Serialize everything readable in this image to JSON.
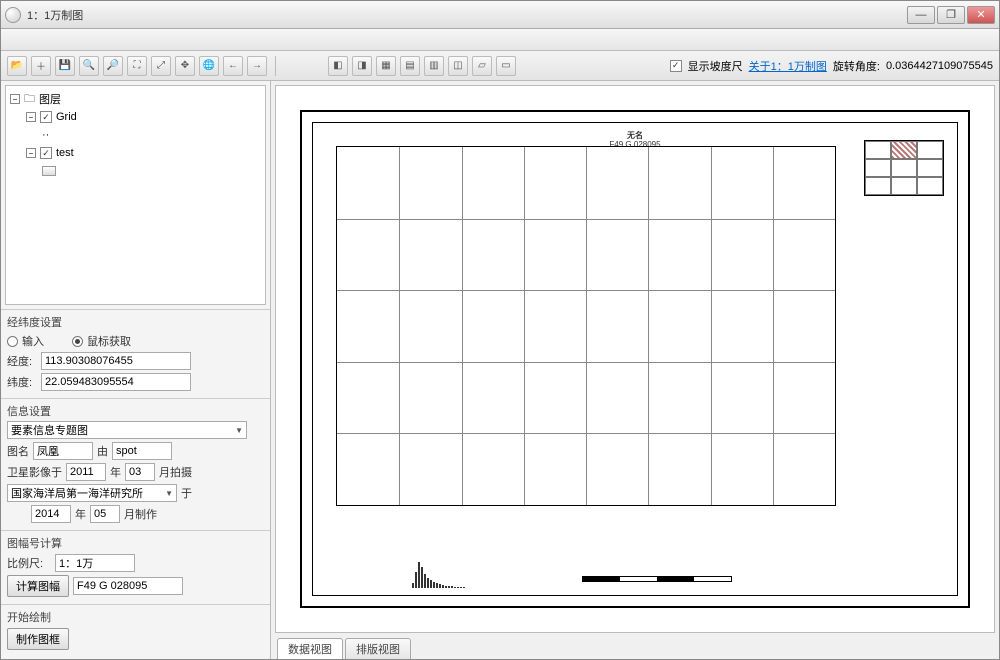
{
  "window": {
    "title": "1：1万制图"
  },
  "menubar": {
    "items": [
      "",
      "",
      ""
    ]
  },
  "toolbar": {
    "show_scale_label": "显示坡度尺",
    "about_label": "关于1：1万制图",
    "rotation_label": "旋转角度:",
    "rotation_value": "0.0364427109075545"
  },
  "tree": {
    "root": "图层",
    "items": [
      {
        "label": "Grid",
        "checked": true
      },
      {
        "label": "test",
        "checked": true
      }
    ]
  },
  "coord": {
    "header": "经纬度设置",
    "opt_input": "输入",
    "opt_mouse": "鼠标获取",
    "lon_label": "经度:",
    "lon_value": "113.90308076455",
    "lat_label": "纬度:",
    "lat_value": "22.059483095554"
  },
  "info": {
    "header": "信息设置",
    "theme": "要素信息专题图",
    "mapname_label": "图名",
    "mapname_value": "凤凰",
    "by_label": "由",
    "by_value": "spot",
    "sat_prefix": "卫星影像于",
    "year1": "2011",
    "year_unit": "年",
    "month1": "03",
    "month_suffix": "月拍摄",
    "org": "国家海洋局第一海洋研究所",
    "yu": "于",
    "year2": "2014",
    "month2": "05",
    "made_suffix": "月制作"
  },
  "calc": {
    "header": "图幅号计算",
    "scale_label": "比例尺:",
    "scale_value": "1：1万",
    "button": "计算图幅",
    "result": "F49 G 028095"
  },
  "draw": {
    "header": "开始绘制",
    "button": "制作图框"
  },
  "map": {
    "title": "无名",
    "subtitle": "F49 G 028095"
  },
  "tabs": {
    "data": "数据视图",
    "layout": "排版视图"
  }
}
